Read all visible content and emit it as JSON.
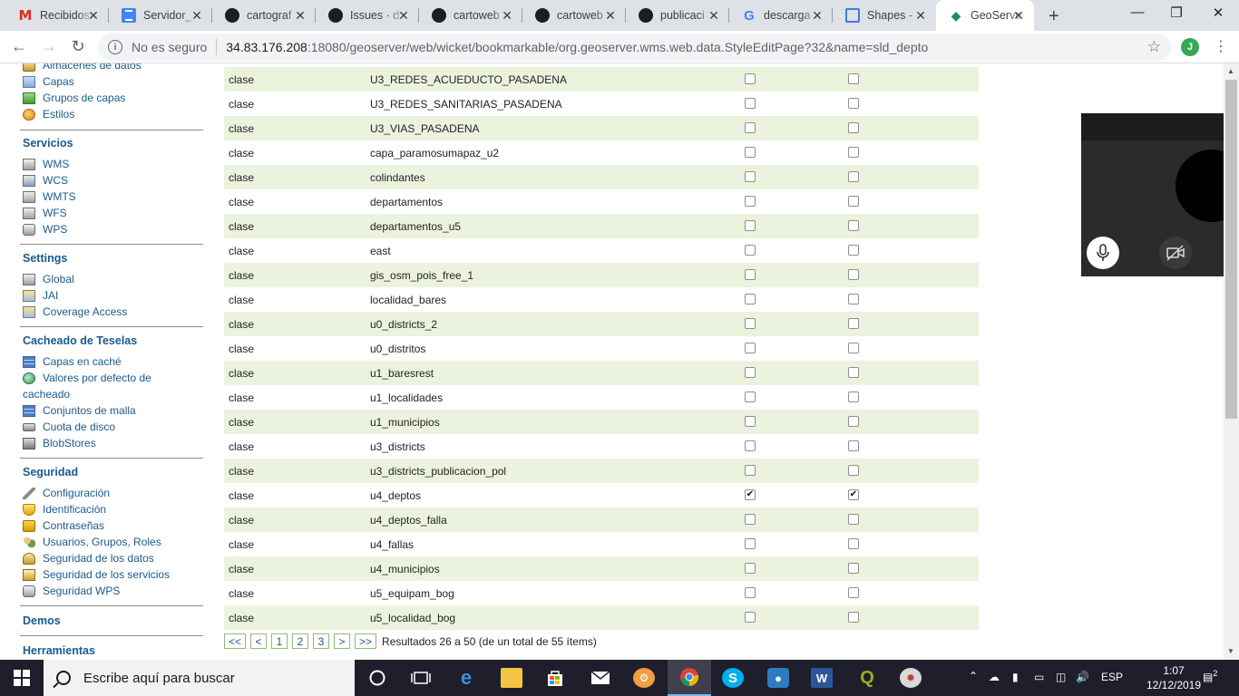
{
  "browser": {
    "tabs": [
      {
        "title": "Recibidos",
        "icon": "gmail-icon"
      },
      {
        "title": "Servidor_",
        "icon": "docs-icon"
      },
      {
        "title": "cartograf",
        "icon": "github-icon"
      },
      {
        "title": "Issues · d",
        "icon": "github-icon"
      },
      {
        "title": "cartoweb",
        "icon": "github-icon"
      },
      {
        "title": "cartoweb",
        "icon": "github-icon"
      },
      {
        "title": "publicaci",
        "icon": "github-icon"
      },
      {
        "title": "descarga",
        "icon": "google-icon"
      },
      {
        "title": "Shapes -",
        "icon": "shapes-icon"
      },
      {
        "title": "GeoServer",
        "icon": "geoserver-icon"
      }
    ],
    "address": {
      "security": "No es seguro",
      "host": "34.83.176.208",
      "path": ":18080/geoserver/web/wicket/bookmarkable/org.geoserver.wms.web.data.StyleEditPage?32&name=sld_depto"
    },
    "profile_initial": "J"
  },
  "sidebar": {
    "data_items": [
      {
        "label": "Almacenes de datos",
        "icon": "datastore-icon"
      },
      {
        "label": "Capas",
        "icon": "layers-icon"
      },
      {
        "label": "Grupos de capas",
        "icon": "layergroups-icon"
      },
      {
        "label": "Estilos",
        "icon": "styles-icon"
      }
    ],
    "services_heading": "Servicios",
    "services": [
      {
        "label": "WMS",
        "icon": "wms-icon"
      },
      {
        "label": "WCS",
        "icon": "wcs-icon"
      },
      {
        "label": "WMTS",
        "icon": "wmts-icon"
      },
      {
        "label": "WFS",
        "icon": "wfs-icon"
      },
      {
        "label": "WPS",
        "icon": "wps-icon"
      }
    ],
    "settings_heading": "Settings",
    "settings": [
      {
        "label": "Global",
        "icon": "global-icon"
      },
      {
        "label": "JAI",
        "icon": "jai-icon"
      },
      {
        "label": "Coverage Access",
        "icon": "coverage-access-icon"
      }
    ],
    "tiles_heading": "Cacheado de Teselas",
    "tiles": [
      {
        "label": "Capas en caché",
        "icon": "tile-layers-icon"
      },
      {
        "label": "Valores por defecto de",
        "label2": "cacheado",
        "icon": "defaults-globe-icon"
      },
      {
        "label": "Conjuntos de malla",
        "icon": "gridsets-icon"
      },
      {
        "label": "Cuota de disco",
        "icon": "disk-quota-icon"
      },
      {
        "label": "BlobStores",
        "icon": "blobstores-icon"
      }
    ],
    "security_heading": "Seguridad",
    "security": [
      {
        "label": "Configuración",
        "icon": "config-key-icon"
      },
      {
        "label": "Identificación",
        "icon": "auth-shield-icon"
      },
      {
        "label": "Contraseñas",
        "icon": "passwords-lock-icon"
      },
      {
        "label": "Usuarios, Grupos, Roles",
        "icon": "users-icon"
      },
      {
        "label": "Seguridad de los datos",
        "icon": "data-security-icon"
      },
      {
        "label": "Seguridad de los servicios",
        "icon": "service-security-icon"
      },
      {
        "label": "Seguridad WPS",
        "icon": "wps-security-icon"
      }
    ],
    "demos_heading": "Demos",
    "tools_heading": "Herramientas"
  },
  "table": {
    "rows": [
      {
        "c1": "clase",
        "c2": "U3_REDES_ACUEDUCTO_PASADENA",
        "a": false,
        "b": false
      },
      {
        "c1": "clase",
        "c2": "U3_REDES_SANITARIAS_PASADENA",
        "a": false,
        "b": false
      },
      {
        "c1": "clase",
        "c2": "U3_VIAS_PASADENA",
        "a": false,
        "b": false
      },
      {
        "c1": "clase",
        "c2": "capa_paramosumapaz_u2",
        "a": false,
        "b": false
      },
      {
        "c1": "clase",
        "c2": "colindantes",
        "a": false,
        "b": false
      },
      {
        "c1": "clase",
        "c2": "departamentos",
        "a": false,
        "b": false
      },
      {
        "c1": "clase",
        "c2": "departamentos_u5",
        "a": false,
        "b": false
      },
      {
        "c1": "clase",
        "c2": "east",
        "a": false,
        "b": false
      },
      {
        "c1": "clase",
        "c2": "gis_osm_pois_free_1",
        "a": false,
        "b": false
      },
      {
        "c1": "clase",
        "c2": "localidad_bares",
        "a": false,
        "b": false
      },
      {
        "c1": "clase",
        "c2": "u0_districts_2",
        "a": false,
        "b": false
      },
      {
        "c1": "clase",
        "c2": "u0_distritos",
        "a": false,
        "b": false
      },
      {
        "c1": "clase",
        "c2": "u1_baresrest",
        "a": false,
        "b": false
      },
      {
        "c1": "clase",
        "c2": "u1_localidades",
        "a": false,
        "b": false
      },
      {
        "c1": "clase",
        "c2": "u1_municipios",
        "a": false,
        "b": false
      },
      {
        "c1": "clase",
        "c2": "u3_districts",
        "a": false,
        "b": false
      },
      {
        "c1": "clase",
        "c2": "u3_districts_publicacion_pol",
        "a": false,
        "b": false
      },
      {
        "c1": "clase",
        "c2": "u4_deptos",
        "a": true,
        "b": true
      },
      {
        "c1": "clase",
        "c2": "u4_deptos_falla",
        "a": false,
        "b": false
      },
      {
        "c1": "clase",
        "c2": "u4_fallas",
        "a": false,
        "b": false
      },
      {
        "c1": "clase",
        "c2": "u4_municipios",
        "a": false,
        "b": false
      },
      {
        "c1": "clase",
        "c2": "u5_equipam_bog",
        "a": false,
        "b": false
      },
      {
        "c1": "clase",
        "c2": "u5_localidad_bog",
        "a": false,
        "b": false
      }
    ]
  },
  "pager": {
    "first": "<<",
    "prev": "<",
    "pages": [
      "1",
      "2",
      "3"
    ],
    "next": ">",
    "last": ">>",
    "info": "Resultados 26 a 50 (de un total de 55 ítems)"
  },
  "taskbar": {
    "search_placeholder": "Escribe aquí para buscar",
    "lang": "ESP",
    "time": "1:07",
    "date": "12/12/2019",
    "notifications": "2"
  },
  "colors": {
    "link": "#1b5a8c",
    "row_alt": "#ebf3de",
    "taskbar": "#1f1f2b"
  }
}
